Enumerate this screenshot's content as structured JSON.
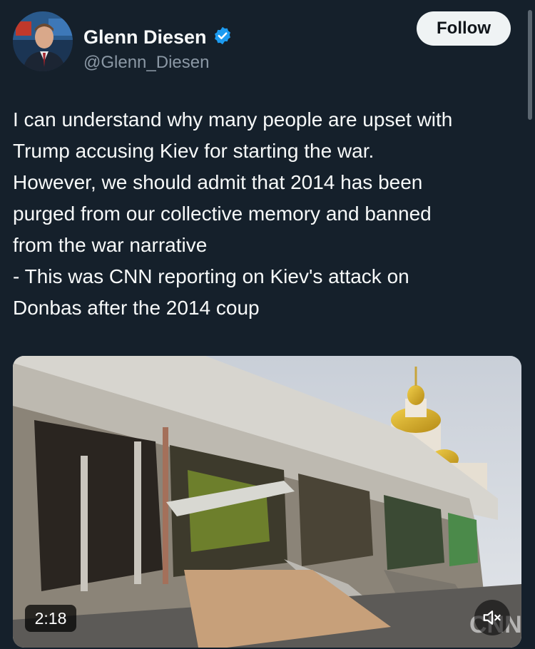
{
  "author": {
    "name": "Glenn Diesen",
    "handle": "@Glenn_Diesen",
    "verified_icon": "verified-badge-icon",
    "avatar_icon": "avatar"
  },
  "actions": {
    "follow_label": "Follow"
  },
  "tweet": {
    "lines": [
      "I can understand why many people are upset with",
      "Trump accusing Kiev for starting the war.",
      "However, we should admit that 2014 has been",
      "purged from our collective memory and banned",
      "from the war narrative",
      "- This was CNN reporting on Kiev's attack on",
      "Donbas after the 2014 coup"
    ]
  },
  "media": {
    "type": "video",
    "duration": "2:18",
    "mute_icon": "muted-speaker-icon",
    "watermark_logo": "CNN"
  },
  "colors": {
    "background": "#15202b",
    "text": "#f7f9f9",
    "secondary_text": "#8b98a5",
    "verified": "#1d9bf0",
    "follow_bg": "#eff3f4"
  }
}
